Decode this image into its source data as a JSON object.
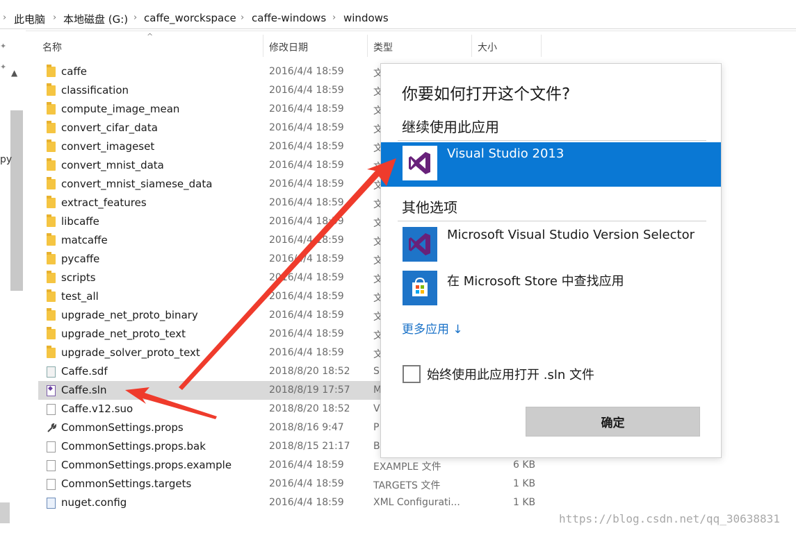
{
  "breadcrumb": [
    "此电脑",
    "本地磁盘 (G:)",
    "caffe_worckspace",
    "caffe-windows",
    "windows"
  ],
  "nav": {
    "partial_text": "py"
  },
  "columns": {
    "name": "名称",
    "date": "修改日期",
    "type": "类型",
    "size": "大小"
  },
  "files": [
    {
      "name": "caffe",
      "date": "2016/4/4 18:59",
      "type": "文",
      "size": "",
      "icon": "folder-icon"
    },
    {
      "name": "classification",
      "date": "2016/4/4 18:59",
      "type": "文",
      "size": "",
      "icon": "folder-icon"
    },
    {
      "name": "compute_image_mean",
      "date": "2016/4/4 18:59",
      "type": "文",
      "size": "",
      "icon": "folder-icon"
    },
    {
      "name": "convert_cifar_data",
      "date": "2016/4/4 18:59",
      "type": "文",
      "size": "",
      "icon": "folder-icon"
    },
    {
      "name": "convert_imageset",
      "date": "2016/4/4 18:59",
      "type": "文",
      "size": "",
      "icon": "folder-icon"
    },
    {
      "name": "convert_mnist_data",
      "date": "2016/4/4 18:59",
      "type": "文",
      "size": "",
      "icon": "folder-icon"
    },
    {
      "name": "convert_mnist_siamese_data",
      "date": "2016/4/4 18:59",
      "type": "文",
      "size": "",
      "icon": "folder-icon"
    },
    {
      "name": "extract_features",
      "date": "2016/4/4 18:59",
      "type": "文",
      "size": "",
      "icon": "folder-icon"
    },
    {
      "name": "libcaffe",
      "date": "2016/4/4 18:59",
      "type": "文",
      "size": "",
      "icon": "folder-icon"
    },
    {
      "name": "matcaffe",
      "date": "2016/4/4 18:59",
      "type": "文",
      "size": "",
      "icon": "folder-icon"
    },
    {
      "name": "pycaffe",
      "date": "2016/4/4 18:59",
      "type": "文",
      "size": "",
      "icon": "folder-icon"
    },
    {
      "name": "scripts",
      "date": "2016/4/4 18:59",
      "type": "文",
      "size": "",
      "icon": "folder-icon"
    },
    {
      "name": "test_all",
      "date": "2016/4/4 18:59",
      "type": "文",
      "size": "",
      "icon": "folder-icon"
    },
    {
      "name": "upgrade_net_proto_binary",
      "date": "2016/4/4 18:59",
      "type": "文",
      "size": "",
      "icon": "folder-icon"
    },
    {
      "name": "upgrade_net_proto_text",
      "date": "2016/4/4 18:59",
      "type": "文",
      "size": "",
      "icon": "folder-icon"
    },
    {
      "name": "upgrade_solver_proto_text",
      "date": "2016/4/4 18:59",
      "type": "文",
      "size": "",
      "icon": "folder-icon"
    },
    {
      "name": "Caffe.sdf",
      "date": "2018/8/20 18:52",
      "type": "S",
      "size": "",
      "icon": "sdf-file-icon"
    },
    {
      "name": "Caffe.sln",
      "date": "2018/8/19 17:57",
      "type": "M",
      "size": "",
      "icon": "sln-file-icon",
      "selected": true
    },
    {
      "name": "Caffe.v12.suo",
      "date": "2018/8/20 18:52",
      "type": "V",
      "size": "",
      "icon": "file-icon"
    },
    {
      "name": "CommonSettings.props",
      "date": "2018/8/16 9:47",
      "type": "P",
      "size": "",
      "icon": "wrench-icon"
    },
    {
      "name": "CommonSettings.props.bak",
      "date": "2018/8/15 21:17",
      "type": "B",
      "size": "",
      "icon": "file-icon"
    },
    {
      "name": "CommonSettings.props.example",
      "date": "2016/4/4 18:59",
      "type": "EXAMPLE 文件",
      "size": "6 KB",
      "icon": "file-icon"
    },
    {
      "name": "CommonSettings.targets",
      "date": "2016/4/4 18:59",
      "type": "TARGETS 文件",
      "size": "1 KB",
      "icon": "file-icon"
    },
    {
      "name": "nuget.config",
      "date": "2016/4/4 18:59",
      "type": "XML Configurati...",
      "size": "1 KB",
      "icon": "config-file-icon"
    }
  ],
  "dialog": {
    "title": "你要如何打开这个文件?",
    "continue_label": "继续使用此应用",
    "primary_app": "Visual Studio 2013",
    "other_label": "其他选项",
    "other_apps": [
      "Microsoft Visual Studio Version Selector",
      "在 Microsoft Store 中查找应用"
    ],
    "more_apps": "更多应用 ↓",
    "always_use": "始终使用此应用打开 .sln 文件",
    "ok": "确定"
  },
  "colors": {
    "selection_blue": "#0a78d4",
    "link_blue": "#1a72c8",
    "arrow_red": "#ef3b2c"
  },
  "watermark": "https://blog.csdn.net/qq_30638831"
}
